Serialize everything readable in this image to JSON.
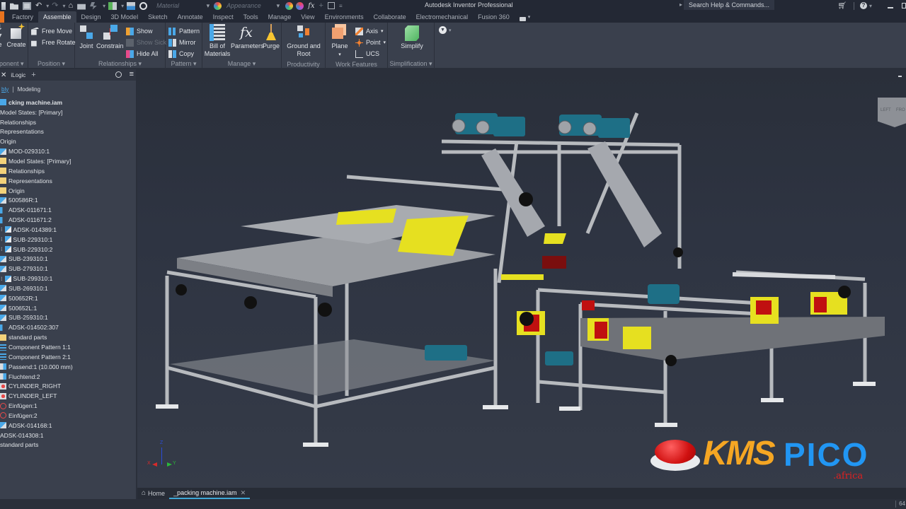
{
  "app": {
    "title": "Autodesk Inventor Professional",
    "search_placeholder": "Search Help & Commands..."
  },
  "quick_access": {
    "material_placeholder": "Material",
    "appearance_placeholder": "Appearance",
    "fx_label": "fx"
  },
  "tabs": [
    {
      "label": "Factory"
    },
    {
      "label": "Assemble",
      "active": true
    },
    {
      "label": "Design"
    },
    {
      "label": "3D Model"
    },
    {
      "label": "Sketch"
    },
    {
      "label": "Annotate"
    },
    {
      "label": "Inspect"
    },
    {
      "label": "Tools"
    },
    {
      "label": "Manage"
    },
    {
      "label": "View"
    },
    {
      "label": "Environments"
    },
    {
      "label": "Collaborate"
    },
    {
      "label": "Electromechanical"
    },
    {
      "label": "Fusion 360"
    }
  ],
  "ribbon": {
    "component": {
      "panel_label": "Component",
      "place_label": "e",
      "create_label": "Create"
    },
    "position": {
      "panel_label": "Position",
      "free_move": "Free Move",
      "free_rotate": "Free Rotate"
    },
    "relationships": {
      "panel_label": "Relationships",
      "joint": "Joint",
      "constrain": "Constrain",
      "show": "Show",
      "show_sick": "Show Sick",
      "hide_all": "Hide All"
    },
    "pattern": {
      "panel_label": "Pattern",
      "pattern": "Pattern",
      "mirror": "Mirror",
      "copy": "Copy"
    },
    "manage": {
      "panel_label": "Manage",
      "bom_line1": "Bill of",
      "bom_line2": "Materials",
      "parameters": "Parameters",
      "purge": "Purge"
    },
    "productivity": {
      "panel_label": "Productivity",
      "ground_line1": "Ground and",
      "ground_line2": "Root"
    },
    "work_features": {
      "panel_label": "Work Features",
      "plane": "Plane",
      "axis": "Axis",
      "point": "Point",
      "ucs": "UCS"
    },
    "simplification": {
      "panel_label": "Simplification",
      "simplify": "Simplify"
    }
  },
  "browser": {
    "tab_label": "iLogic",
    "sub_tab_active": "bly",
    "sub_tab_other": "Modeling",
    "items": [
      {
        "label": "cking machine.iam",
        "icon": "assembly",
        "indent": 0,
        "bold": true
      },
      {
        "label": "Model States: [Primary]",
        "icon": "none",
        "indent": 0
      },
      {
        "label": "Relationships",
        "icon": "none",
        "indent": 0
      },
      {
        "label": "Representations",
        "icon": "none",
        "indent": 0
      },
      {
        "label": "Origin",
        "icon": "none",
        "indent": 0
      },
      {
        "label": "MOD-029310:1",
        "icon": "subassembly",
        "indent": 1
      },
      {
        "label": "Model States: [Primary]",
        "icon": "folder",
        "indent": 1
      },
      {
        "label": "Relationships",
        "icon": "folder",
        "indent": 1
      },
      {
        "label": "Representations",
        "icon": "folder",
        "indent": 1
      },
      {
        "label": "Origin",
        "icon": "folder",
        "indent": 1
      },
      {
        "label": "500586R:1",
        "icon": "subassembly",
        "indent": 1
      },
      {
        "label": "ADSK-011671:1",
        "icon": "part",
        "indent": 1
      },
      {
        "label": "ADSK-011671:2",
        "icon": "part",
        "indent": 1
      },
      {
        "label": "ADSK-014389:1",
        "icon": "pattern-assembly",
        "indent": 2
      },
      {
        "label": "SUB-229310:1",
        "icon": "pattern-assembly",
        "indent": 2
      },
      {
        "label": "SUB-229310:2",
        "icon": "pattern-assembly",
        "indent": 2
      },
      {
        "label": "SUB-239310:1",
        "icon": "subassembly",
        "indent": 1
      },
      {
        "label": "SUB-279310:1",
        "icon": "subassembly",
        "indent": 1
      },
      {
        "label": "SUB-299310:1",
        "icon": "pattern-assembly",
        "indent": 2
      },
      {
        "label": "SUB-269310:1",
        "icon": "subassembly",
        "indent": 1
      },
      {
        "label": "500652R:1",
        "icon": "subassembly",
        "indent": 1
      },
      {
        "label": "500652L:1",
        "icon": "subassembly",
        "indent": 1
      },
      {
        "label": "SUB-259310:1",
        "icon": "subassembly",
        "indent": 1
      },
      {
        "label": "ADSK-014502:307",
        "icon": "part",
        "indent": 1
      },
      {
        "label": "standard parts",
        "icon": "folder",
        "indent": 1
      },
      {
        "label": "Component Pattern 1:1",
        "icon": "component-pattern",
        "indent": 1
      },
      {
        "label": "Component Pattern 2:1",
        "icon": "component-pattern",
        "indent": 1
      },
      {
        "label": "Passend:1 (10.000 mm)",
        "icon": "constraint",
        "indent": 1
      },
      {
        "label": "Fluchtend:2",
        "icon": "constraint",
        "indent": 1
      },
      {
        "label": "CYLINDER_RIGHT",
        "icon": "joint",
        "indent": 1
      },
      {
        "label": "CYLINDER_LEFT",
        "icon": "joint",
        "indent": 1
      },
      {
        "label": "Einfügen:1",
        "icon": "insert",
        "indent": 1
      },
      {
        "label": "Einfügen:2",
        "icon": "insert",
        "indent": 1
      },
      {
        "label": "ADSK-014168:1",
        "icon": "subassembly",
        "indent": 1
      },
      {
        "label": "ADSK-014308:1",
        "icon": "none",
        "indent": 0
      },
      {
        "label": "standard parts",
        "icon": "none",
        "indent": 0
      }
    ]
  },
  "viewcube": {
    "left": "LEFT",
    "front": "FRO"
  },
  "triad": {
    "x": "X",
    "y": "Y",
    "z": "Z"
  },
  "doc_tabs": {
    "home": "Home",
    "active_doc": "_packing machine.iam"
  },
  "watermark": {
    "main1": "KMS",
    "main2": "PICO",
    "sub": ".africa"
  },
  "status": {
    "right_readout": "64"
  },
  "colors": {
    "accent": "#3fa7d6",
    "model_yellow": "#e6e020",
    "motor_teal": "#1e6f86",
    "frame_gray": "#b9bcc0",
    "box_red": "#c01010"
  }
}
